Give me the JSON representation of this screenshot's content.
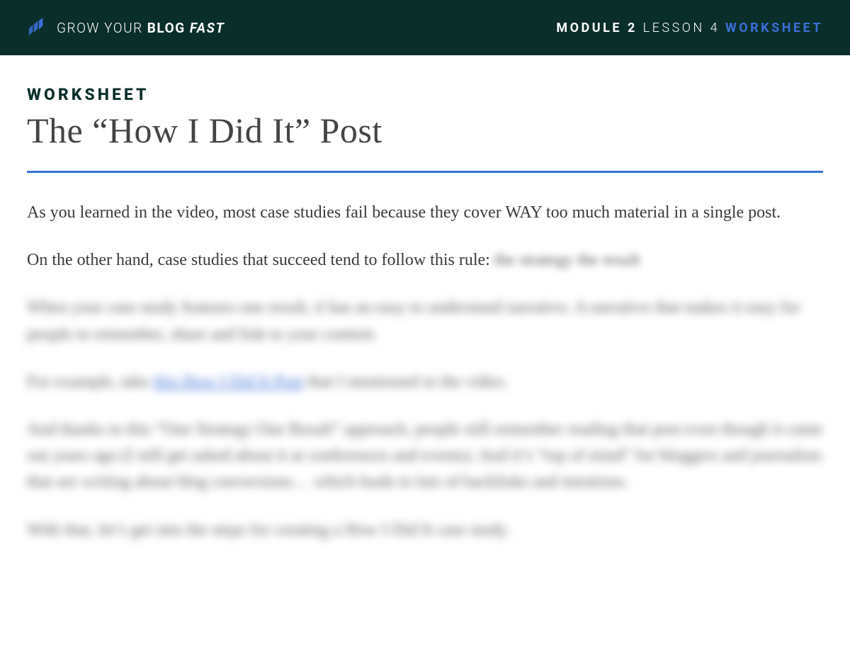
{
  "header": {
    "brand": {
      "part1": "GROW YOUR ",
      "part2": "BLOG ",
      "part3": "FAST"
    },
    "module": {
      "module_bold": "MODULE 2",
      "lesson": " LESSON 4 ",
      "worksheet": "WORKSHEET"
    }
  },
  "content": {
    "eyebrow": "WORKSHEET",
    "title": "The “How I Did It” Post",
    "para1": "As you learned in the video, most case studies fail because they cover WAY too much material in a single post.",
    "para2_lead": "On the other hand, case studies that succeed tend to follow this rule: ",
    "para2_blur": "the strategy the result",
    "blur_para1": "When your case study features one result, it has an easy to understand narrative. A narrative that makes it easy for people to remember, share and link to your content.",
    "blur_para2_a": "For example, take ",
    "blur_para2_link": "this How I Did It Post",
    "blur_para2_b": " that I mentioned in the video.",
    "blur_para3": "And thanks to this “One Strategy One Result” approach, people still remember reading that post even though it came out years ago (I still get asked about it at conferences and events). And it’s “top of mind” for bloggers and journalists that are writing about blog conversions… which leads to lots of backlinks and mentions.",
    "blur_para4": "With that, let’s get into the steps for creating a How I Did It case study."
  }
}
